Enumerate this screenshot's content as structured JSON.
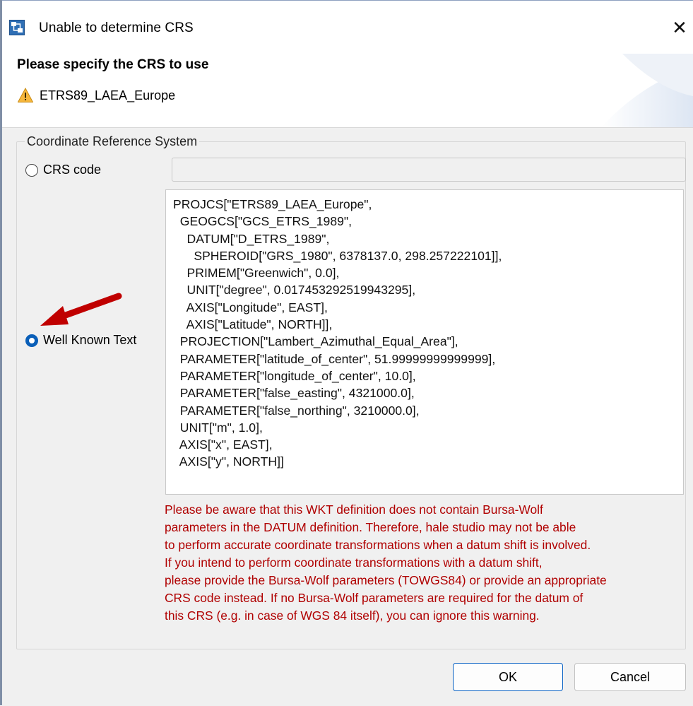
{
  "window": {
    "title": "Unable to determine CRS",
    "close_glyph": "✕"
  },
  "header": {
    "heading": "Please specify the CRS to use",
    "warning_icon": "warning-triangle-icon",
    "message": "ETRS89_LAEA_Europe"
  },
  "group": {
    "legend": "Coordinate Reference System"
  },
  "crs_code": {
    "label": "CRS code",
    "selected": false,
    "value": ""
  },
  "wkt": {
    "label": "Well Known Text",
    "selected": true,
    "lines": [
      "PROJCS[\"ETRS89_LAEA_Europe\",",
      "  GEOGCS[\"GCS_ETRS_1989\",",
      "    DATUM[\"D_ETRS_1989\",",
      "      SPHEROID[\"GRS_1980\", 6378137.0, 298.257222101]],",
      "    PRIMEM[\"Greenwich\", 0.0],",
      "    UNIT[\"degree\", 0.017453292519943295],",
      "    AXIS[\"Longitude\", EAST],",
      "    AXIS[\"Latitude\", NORTH]],",
      "  PROJECTION[\"Lambert_Azimuthal_Equal_Area\"],",
      "  PARAMETER[\"latitude_of_center\", 51.99999999999999],",
      "  PARAMETER[\"longitude_of_center\", 10.0],",
      "  PARAMETER[\"false_easting\", 4321000.0],",
      "  PARAMETER[\"false_northing\", 3210000.0],",
      "  UNIT[\"m\", 1.0],",
      "  AXIS[\"x\", EAST],",
      "  AXIS[\"y\", NORTH]]"
    ]
  },
  "warning": {
    "lines": [
      "Please be aware that this WKT definition does not contain Bursa-Wolf",
      "parameters in the DATUM definition. Therefore, hale studio may not be able",
      "to perform accurate coordinate transformations when a datum shift is involved.",
      "If you intend to perform coordinate transformations with a datum shift,",
      "please provide the Bursa-Wolf parameters (TOWGS84) or provide an appropriate",
      "CRS code instead. If no Bursa-Wolf parameters are required for the datum of",
      "this CRS (e.g. in case of WGS 84 itself), you can ignore this warning."
    ],
    "color": "#b00000"
  },
  "buttons": {
    "ok": "OK",
    "cancel": "Cancel"
  },
  "colors": {
    "accent": "#0a5fb8",
    "annotation_arrow": "#c00000"
  }
}
